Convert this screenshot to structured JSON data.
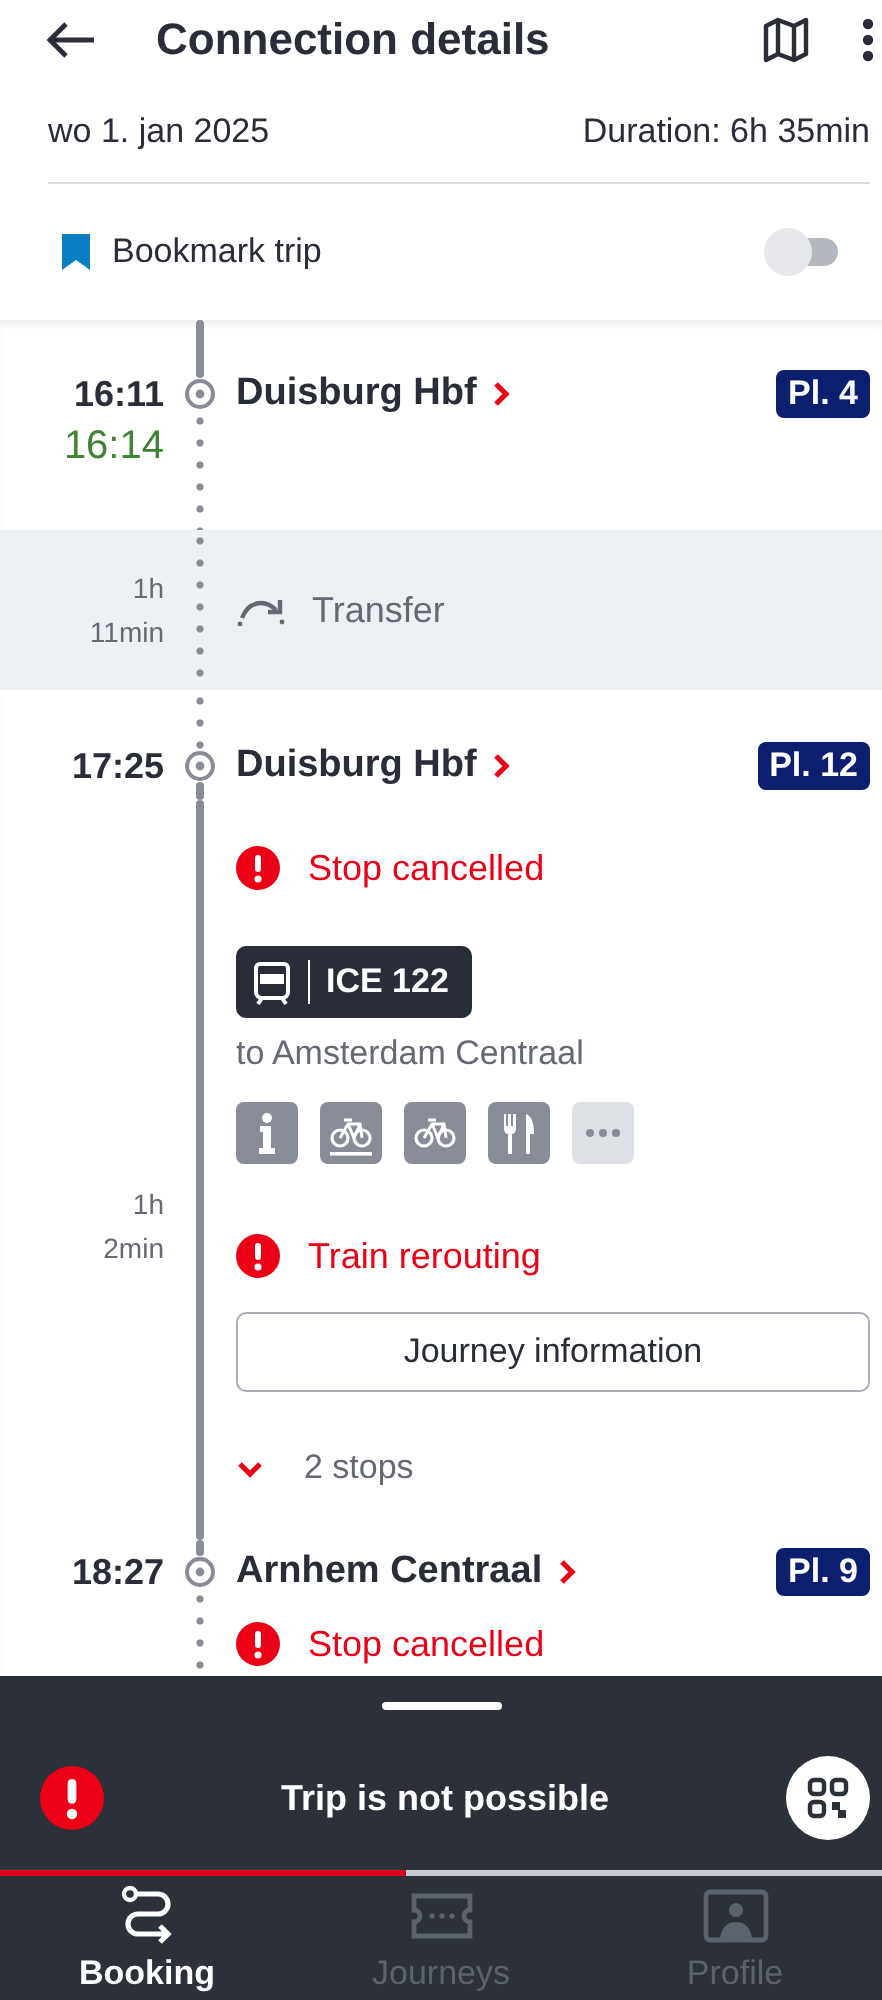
{
  "header": {
    "title": "Connection details"
  },
  "date": "wo 1. jan 2025",
  "duration": "Duration: 6h 35min",
  "bookmark": {
    "label": "Bookmark trip",
    "on": false
  },
  "stop_1": {
    "time": "16:11",
    "actual_time": "16:14",
    "station": "Duisburg Hbf",
    "platform": "Pl. 4"
  },
  "transfer": {
    "duration": "1h 11min",
    "label": "Transfer"
  },
  "stop_2": {
    "time": "17:25",
    "station": "Duisburg Hbf",
    "platform": "Pl. 12"
  },
  "leg": {
    "duration": "1h 2min",
    "notice": "Stop cancelled",
    "train": "ICE 122",
    "destination": "to Amsterdam Centraal",
    "amenities": [
      {
        "kind": "info"
      },
      {
        "kind": "bike_reservation"
      },
      {
        "kind": "bike"
      },
      {
        "kind": "restaurant"
      },
      {
        "kind": "more"
      }
    ],
    "notice_2": "Train rerouting",
    "button": "Journey information",
    "stops": "2 stops",
    "stops_expanded": false
  },
  "stop_3": {
    "time": "18:27",
    "station": "Arnhem Centraal",
    "platform": "Pl. 9",
    "notice": "Stop cancelled"
  },
  "sheet": {
    "status": "Trip is not possible",
    "level": 0.46
  },
  "tabs": [
    {
      "label": "Booking",
      "kind": "route",
      "selected": true
    },
    {
      "label": "Journeys",
      "kind": "ticket",
      "selected": false
    },
    {
      "label": "Profile",
      "kind": "profile",
      "selected": false
    }
  ]
}
